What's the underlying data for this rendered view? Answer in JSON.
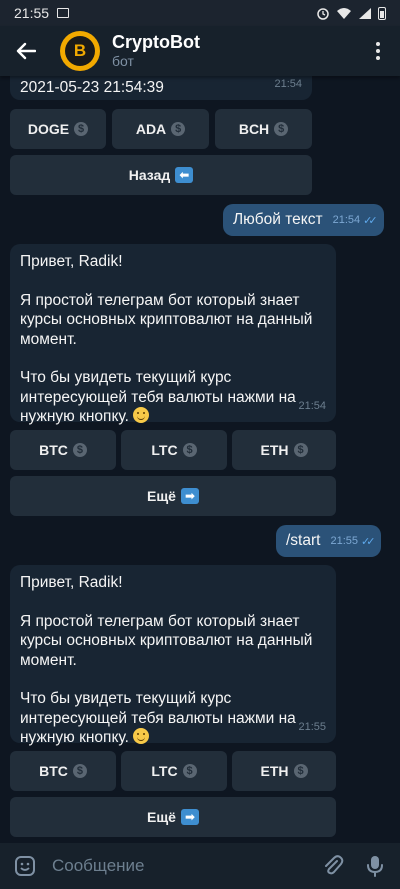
{
  "status_bar": {
    "time": "21:55"
  },
  "header": {
    "back_icon": "arrow-left-icon",
    "title": "CryptoBot",
    "subtitle": "бот",
    "avatar_symbol": "B",
    "menu_icon": "more-vertical-icon"
  },
  "messages": {
    "top_partial": {
      "text": "2021-05-23 21:54:39",
      "time": "21:54"
    },
    "keyboard_top": {
      "row1": [
        "DOGE",
        "ADA",
        "BCH"
      ],
      "back_label": "Назад"
    },
    "out1": {
      "text": "Любой текст",
      "time": "21:54"
    },
    "in1": {
      "greeting": "Привет, Radik!",
      "p2": "Я простой телеграм бот который знает курсы основных криптовалют на данный момент.",
      "p3": "Что бы увидеть текущий курс интересующей тебя валюты нажми на нужную кнопку.",
      "time": "21:54"
    },
    "keyboard_mid": {
      "row1": [
        "BTC",
        "LTC",
        "ETH"
      ],
      "more_label": "Ещё"
    },
    "out2": {
      "text": "/start",
      "time": "21:55"
    },
    "in2": {
      "greeting": "Привет, Radik!",
      "p2": "Я простой телеграм бот который знает курсы основных криптовалют на данный момент.",
      "p3": "Что бы увидеть текущий курс интересующей тебя валюты нажми на нужную кнопку.",
      "time": "21:55"
    },
    "keyboard_bottom": {
      "row1": [
        "BTC",
        "LTC",
        "ETH"
      ],
      "more_label": "Ещё"
    }
  },
  "input_bar": {
    "placeholder": "Сообщение",
    "emoji_icon": "sticker-smile-icon",
    "attach_icon": "paperclip-icon",
    "mic_icon": "microphone-icon"
  },
  "colors": {
    "background": "#0e1621",
    "header": "#17212b",
    "incoming_bubble": "#182533",
    "outgoing_bubble": "#2b5278",
    "keyboard_button": "#222e3a",
    "accent": "#5ea8eb"
  }
}
